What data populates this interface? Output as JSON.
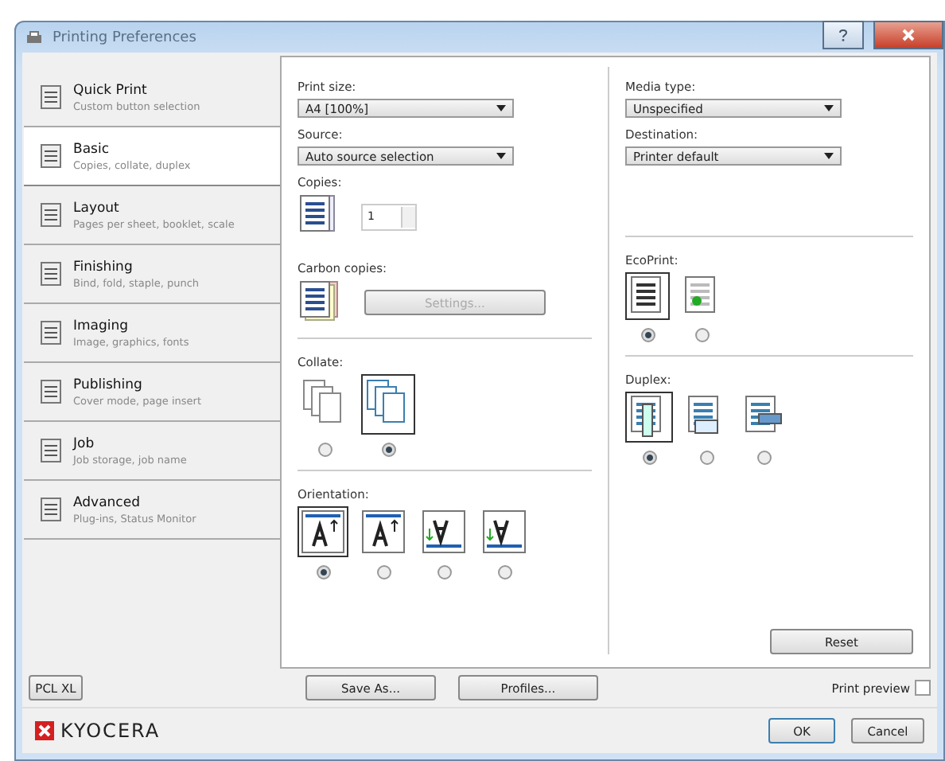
{
  "window": {
    "title": "Printing Preferences"
  },
  "sidebar": {
    "items": [
      {
        "title": "Quick Print",
        "subtitle": "Custom button selection",
        "selected": false
      },
      {
        "title": "Basic",
        "subtitle": "Copies, collate, duplex",
        "selected": true
      },
      {
        "title": "Layout",
        "subtitle": "Pages per sheet, booklet, scale",
        "selected": false
      },
      {
        "title": "Finishing",
        "subtitle": "Bind, fold, staple, punch",
        "selected": false
      },
      {
        "title": "Imaging",
        "subtitle": "Image, graphics, fonts",
        "selected": false
      },
      {
        "title": "Publishing",
        "subtitle": "Cover mode, page insert",
        "selected": false
      },
      {
        "title": "Job",
        "subtitle": "Job storage, job name",
        "selected": false
      },
      {
        "title": "Advanced",
        "subtitle": "Plug-ins, Status Monitor",
        "selected": false
      }
    ]
  },
  "print_size": {
    "label": "Print size:",
    "value": "A4 [100%]"
  },
  "source": {
    "label": "Source:",
    "value": "Auto source selection"
  },
  "copies": {
    "label": "Copies:",
    "value": "1"
  },
  "carbon_copies": {
    "label": "Carbon copies:",
    "button": "Settings...",
    "disabled": true
  },
  "collate": {
    "label": "Collate:",
    "options": [
      {
        "selected": false
      },
      {
        "selected": true
      }
    ]
  },
  "orientation": {
    "label": "Orientation:",
    "options": [
      {
        "selected": true
      },
      {
        "selected": false
      },
      {
        "selected": false
      },
      {
        "selected": false
      }
    ]
  },
  "media_type": {
    "label": "Media type:",
    "value": "Unspecified"
  },
  "destination": {
    "label": "Destination:",
    "value": "Printer default"
  },
  "ecoprint": {
    "label": "EcoPrint:",
    "options": [
      {
        "selected": true
      },
      {
        "selected": false
      }
    ]
  },
  "duplex": {
    "label": "Duplex:",
    "options": [
      {
        "selected": true
      },
      {
        "selected": false
      },
      {
        "selected": false
      }
    ]
  },
  "reset": "Reset",
  "pdl": "PCL XL",
  "save_as": "Save As...",
  "profiles": "Profiles...",
  "print_preview": {
    "label": "Print preview",
    "checked": false
  },
  "logo": "KYOCERA",
  "ok": "OK",
  "cancel": "Cancel"
}
